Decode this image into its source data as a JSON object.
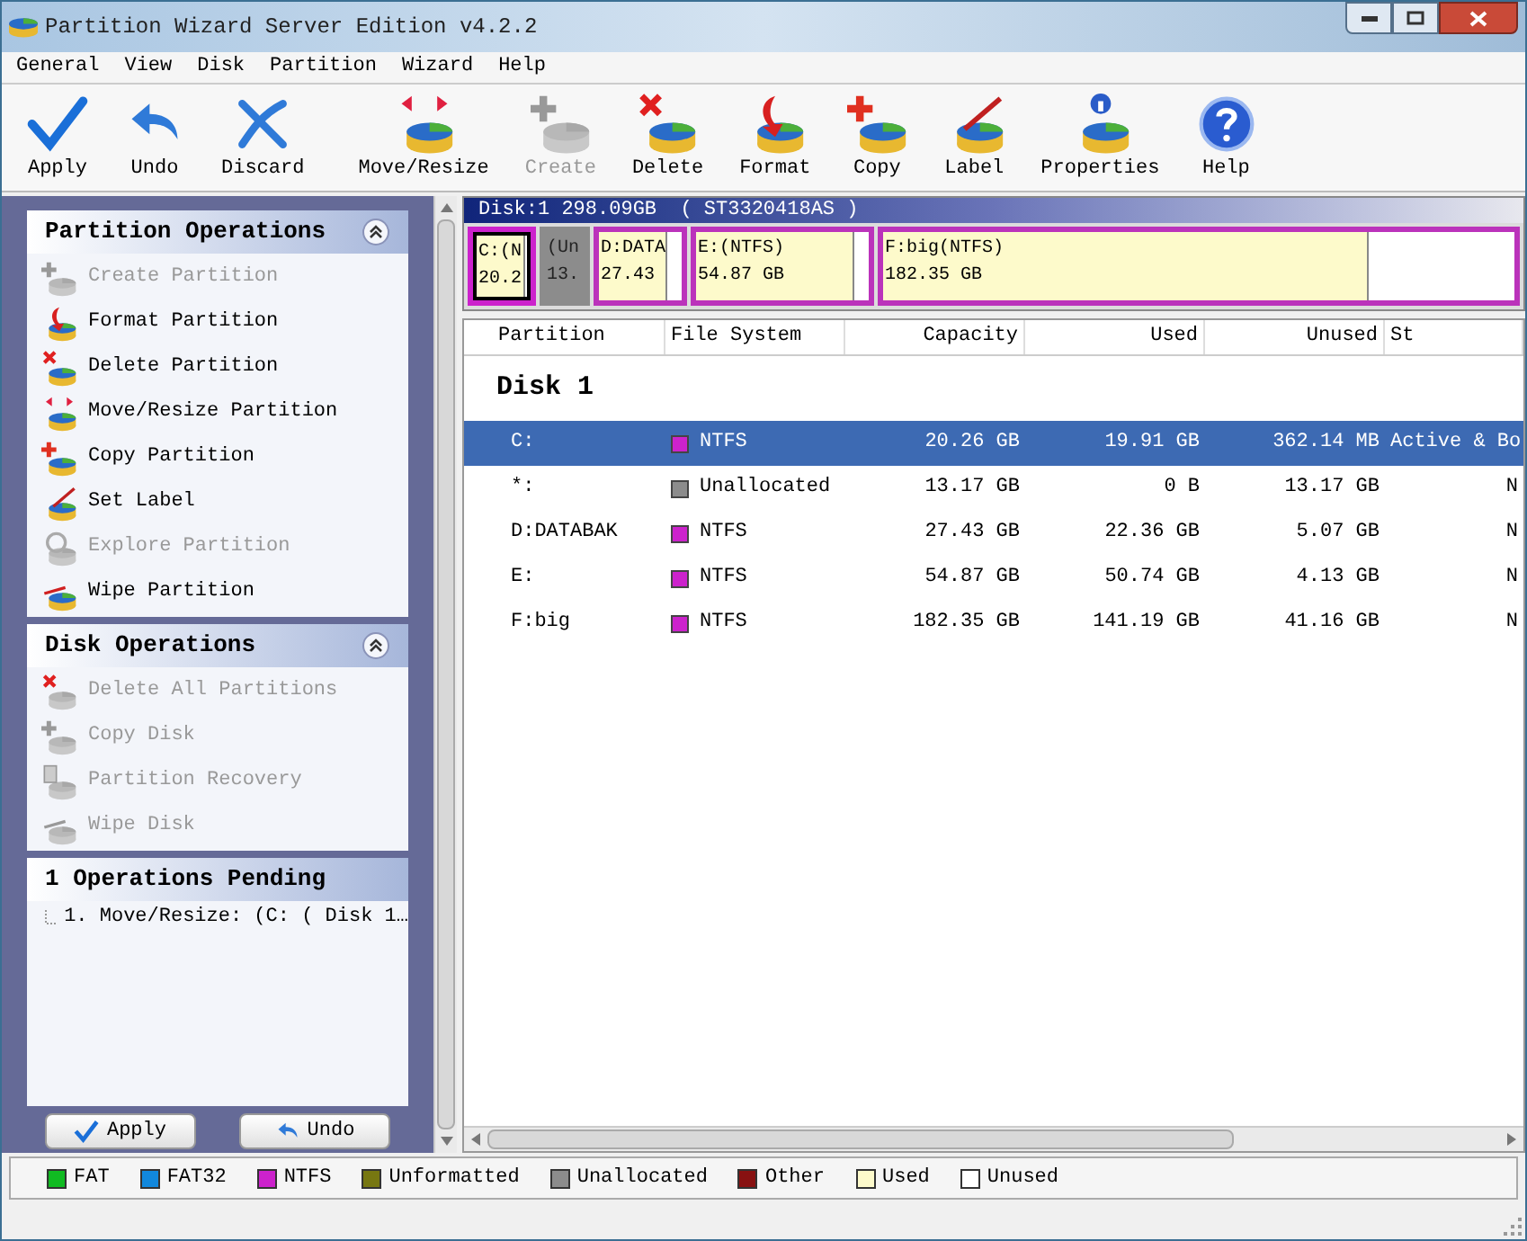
{
  "window": {
    "title": "Partition Wizard Server Edition v4.2.2"
  },
  "menu": [
    "General",
    "View",
    "Disk",
    "Partition",
    "Wizard",
    "Help"
  ],
  "toolbar": [
    {
      "label": "Apply",
      "kind": "check",
      "disabled": false
    },
    {
      "label": "Undo",
      "kind": "undo",
      "disabled": false
    },
    {
      "label": "Discard",
      "kind": "discard",
      "disabled": false
    },
    {
      "label": "Move/Resize",
      "kind": "move",
      "disabled": false
    },
    {
      "label": "Create",
      "kind": "create",
      "disabled": true
    },
    {
      "label": "Delete",
      "kind": "delete",
      "disabled": false
    },
    {
      "label": "Format",
      "kind": "format",
      "disabled": false
    },
    {
      "label": "Copy",
      "kind": "copy",
      "disabled": false
    },
    {
      "label": "Label",
      "kind": "label",
      "disabled": false
    },
    {
      "label": "Properties",
      "kind": "info",
      "disabled": false
    },
    {
      "label": "Help",
      "kind": "help",
      "disabled": false
    }
  ],
  "sidebar": {
    "sections": [
      {
        "title": "Partition Operations",
        "expanded": true,
        "items": [
          {
            "label": "Create Partition",
            "kind": "create",
            "disabled": true
          },
          {
            "label": "Format Partition",
            "kind": "format",
            "disabled": false
          },
          {
            "label": "Delete Partition",
            "kind": "delete",
            "disabled": false
          },
          {
            "label": "Move/Resize Partition",
            "kind": "move",
            "disabled": false
          },
          {
            "label": "Copy Partition",
            "kind": "copy",
            "disabled": false
          },
          {
            "label": "Set Label",
            "kind": "label",
            "disabled": false
          },
          {
            "label": "Explore Partition",
            "kind": "explore",
            "disabled": true
          },
          {
            "label": "Wipe Partition",
            "kind": "wipe",
            "disabled": false
          }
        ]
      },
      {
        "title": "Disk Operations",
        "expanded": true,
        "items": [
          {
            "label": "Delete All Partitions",
            "kind": "delete",
            "disabled": true
          },
          {
            "label": "Copy Disk",
            "kind": "copy",
            "disabled": true
          },
          {
            "label": "Partition Recovery",
            "kind": "recovery",
            "disabled": true
          },
          {
            "label": "Wipe Disk",
            "kind": "wipe",
            "disabled": true
          }
        ]
      }
    ],
    "pending": {
      "title": "1 Operations Pending",
      "items": [
        "1. Move/Resize: (C: ( Disk 1…"
      ]
    },
    "buttons": [
      "Apply",
      "Undo"
    ]
  },
  "disk_map": {
    "header": "Disk:1 298.09GB  ( ST3320418AS )",
    "partitions": [
      {
        "label": "C:(N",
        "size": "20.2",
        "color": "#cc22cc",
        "level": 0.98,
        "selected": true,
        "kind": "partition"
      },
      {
        "label": "(Un",
        "size": "13.",
        "color": "#8c8c8c",
        "selected": false,
        "kind": "unallocated"
      },
      {
        "label": "D:DATA",
        "size": "27.43",
        "color": "#bb33bb",
        "level": 0.82,
        "selected": false,
        "kind": "partition"
      },
      {
        "label": "E:(NTFS)",
        "size": "54.87 GB",
        "color": "#bb33bb",
        "level": 0.92,
        "selected": false,
        "kind": "partition"
      },
      {
        "label": "F:big(NTFS)",
        "size": "182.35 GB",
        "color": "#bb33bb",
        "level": 0.77,
        "selected": false,
        "kind": "partition"
      }
    ]
  },
  "table": {
    "columns": [
      "Partition",
      "File System",
      "Capacity",
      "Used",
      "Unused",
      "St"
    ],
    "group": "Disk 1",
    "rows": [
      {
        "partition": "C:",
        "fs": "NTFS",
        "color": "#cc22cc",
        "capacity": "20.26 GB",
        "used": "19.91 GB",
        "unused": "362.14 MB",
        "status": "Active & Bo",
        "selected": true
      },
      {
        "partition": "*:",
        "fs": "Unallocated",
        "color": "#8c8c8c",
        "capacity": "13.17 GB",
        "used": "0 B",
        "unused": "13.17 GB",
        "status": "N",
        "selected": false
      },
      {
        "partition": "D:DATABAK",
        "fs": "NTFS",
        "color": "#cc22cc",
        "capacity": "27.43 GB",
        "used": "22.36 GB",
        "unused": "5.07 GB",
        "status": "N",
        "selected": false
      },
      {
        "partition": "E:",
        "fs": "NTFS",
        "color": "#cc22cc",
        "capacity": "54.87 GB",
        "used": "50.74 GB",
        "unused": "4.13 GB",
        "status": "N",
        "selected": false
      },
      {
        "partition": "F:big",
        "fs": "NTFS",
        "color": "#cc22cc",
        "capacity": "182.35 GB",
        "used": "141.19 GB",
        "unused": "41.16 GB",
        "status": "N",
        "selected": false
      }
    ]
  },
  "legend": [
    {
      "label": "FAT",
      "color": "#11bb22"
    },
    {
      "label": "FAT32",
      "color": "#1188dd"
    },
    {
      "label": "NTFS",
      "color": "#cc22cc"
    },
    {
      "label": "Unformatted",
      "color": "#777711"
    },
    {
      "label": "Unallocated",
      "color": "#8c8c8c"
    },
    {
      "label": "Other",
      "color": "#881111"
    },
    {
      "label": "Used",
      "color": "#fdfacb"
    },
    {
      "label": "Unused",
      "color": "#ffffff"
    }
  ]
}
